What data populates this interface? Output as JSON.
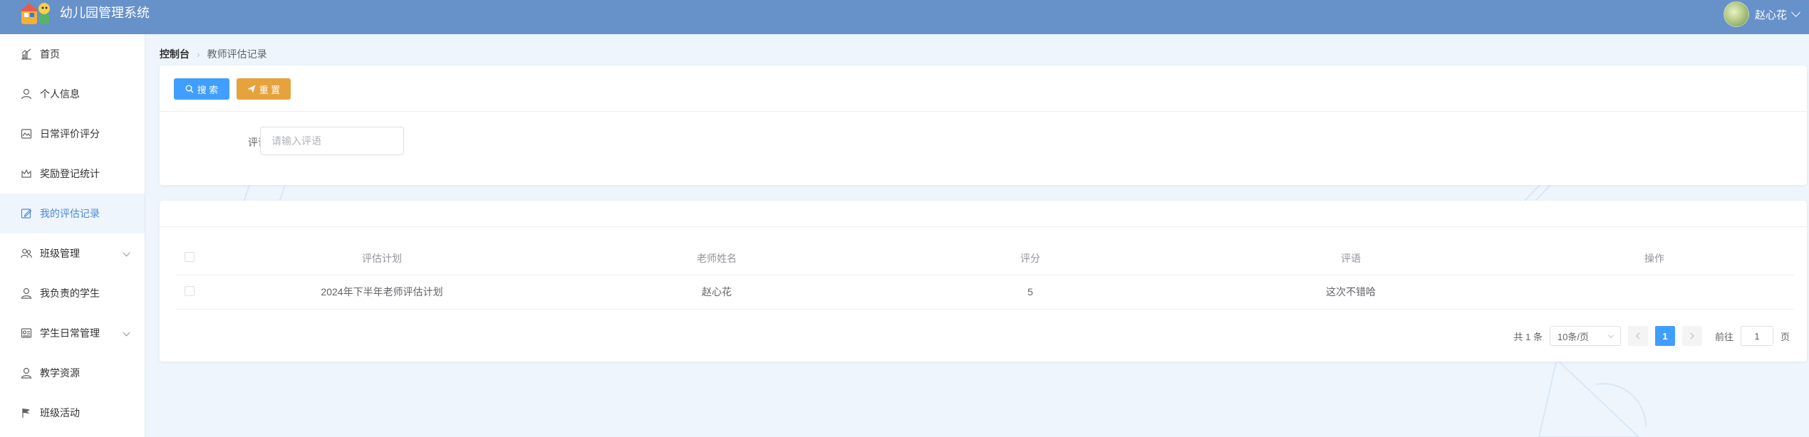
{
  "header": {
    "app_title": "幼儿园管理系统",
    "user_name": "赵心花"
  },
  "sidebar": {
    "items": [
      {
        "label": "首页",
        "icon": "chart-icon"
      },
      {
        "label": "个人信息",
        "icon": "user-icon"
      },
      {
        "label": "日常评价评分",
        "icon": "image-icon"
      },
      {
        "label": "奖励登记统计",
        "icon": "crown-icon"
      },
      {
        "label": "我的评估记录",
        "icon": "edit-icon",
        "active": true
      },
      {
        "label": "班级管理",
        "icon": "team-icon",
        "expandable": true
      },
      {
        "label": "我负责的学生",
        "icon": "person-icon"
      },
      {
        "label": "学生日常管理",
        "icon": "report-icon",
        "expandable": true
      },
      {
        "label": "教学资源",
        "icon": "person-icon"
      },
      {
        "label": "班级活动",
        "icon": "flag-icon"
      }
    ]
  },
  "breadcrumb": {
    "home": "控制台",
    "current": "教师评估记录"
  },
  "search": {
    "search_button": "搜 索",
    "reset_button": "重 置",
    "comment_label": "评语",
    "comment_placeholder": "请输入评语",
    "comment_value": ""
  },
  "table": {
    "columns": [
      "评估计划",
      "老师姓名",
      "评分",
      "评语",
      "操作"
    ],
    "rows": [
      {
        "plan": "2024年下半年老师评估计划",
        "teacher": "赵心花",
        "score": "5",
        "comment": "这次不错哈",
        "action": ""
      }
    ]
  },
  "pagination": {
    "total": "共 1 条",
    "page_size": "10条/页",
    "current_page": "1",
    "goto_prefix": "前往",
    "goto_value": "1",
    "goto_suffix": "页"
  },
  "colors": {
    "header_bg": "#6791c9",
    "primary": "#409eff",
    "warning": "#e6a23c",
    "active_menu_text": "#4a8ad4"
  }
}
